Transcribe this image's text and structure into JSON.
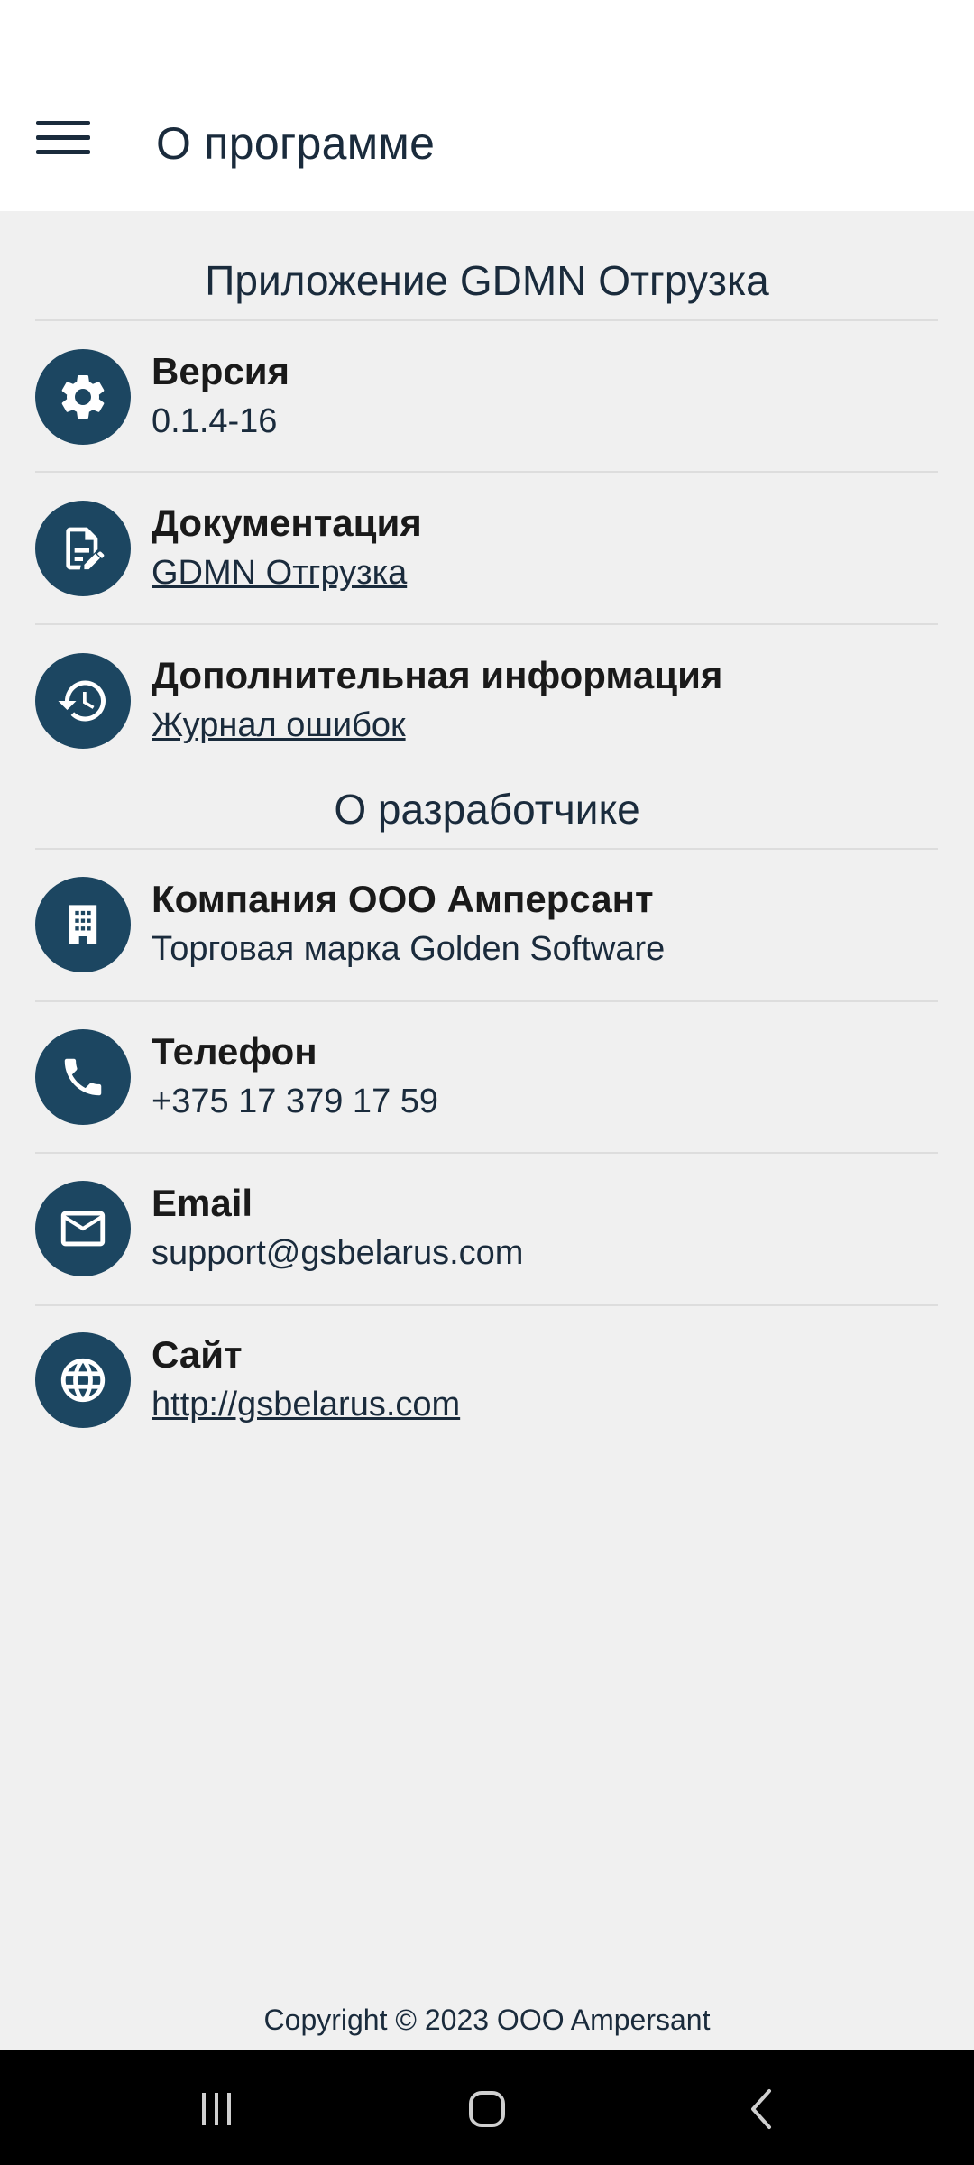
{
  "app_bar": {
    "title": "О программе",
    "menu_icon": "hamburger-menu-icon"
  },
  "sections": {
    "app": "Приложение GDMN Отгрузка",
    "developer": "О разработчике"
  },
  "app_items": [
    {
      "icon": "gear-icon",
      "title": "Версия",
      "value": "0.1.4-16"
    },
    {
      "icon": "document-edit-icon",
      "title": "Документация",
      "value": "GDMN Отгрузка"
    },
    {
      "icon": "history-icon",
      "title": "Дополнительная информация",
      "value": "Журнал ошибок"
    }
  ],
  "developer_items": [
    {
      "icon": "building-icon",
      "title": "Компания ООО Амперсант",
      "value": "Торговая марка Golden Software"
    },
    {
      "icon": "phone-icon",
      "title": "Телефон",
      "value": "+375 17 379 17 59"
    },
    {
      "icon": "email-icon",
      "title": "Email",
      "value": "support@gsbelarus.com"
    },
    {
      "icon": "globe-icon",
      "title": "Сайт",
      "value": "http://gsbelarus.com"
    }
  ],
  "footer": {
    "copyright": "Copyright © 2023 OOO Ampersant"
  },
  "colors": {
    "accent": "#1c4661",
    "text": "#1a2b3c",
    "background": "#f0f0f0"
  }
}
